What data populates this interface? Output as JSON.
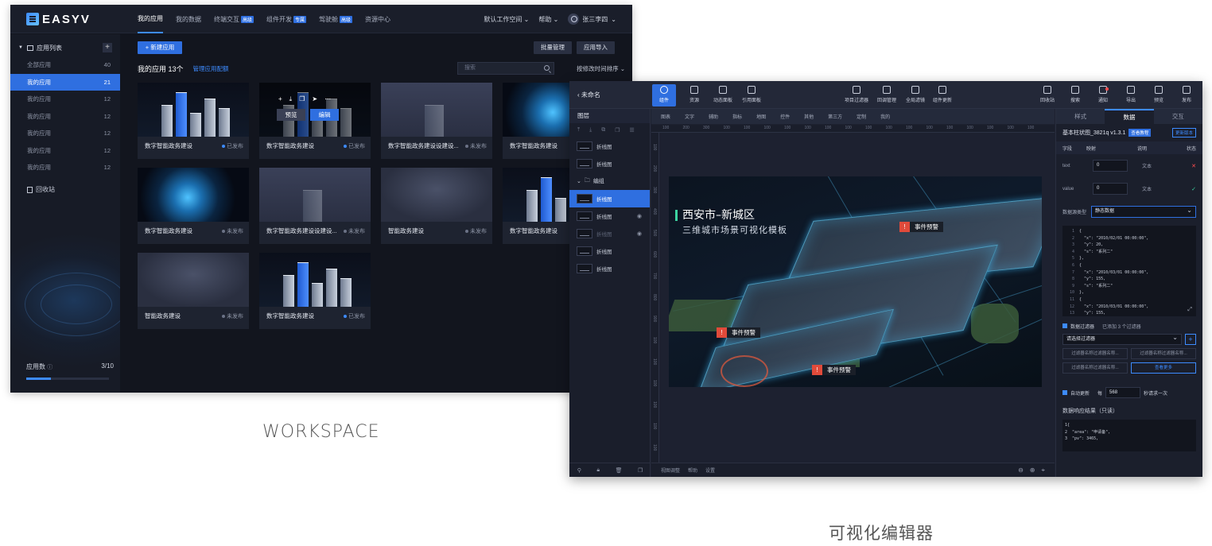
{
  "captions": {
    "workspace": "WORKSPACE",
    "editor": "可视化编辑器"
  },
  "workspace": {
    "logo": "EASYV",
    "nav": [
      {
        "label": "我的应用",
        "tag": ""
      },
      {
        "label": "我的数据",
        "tag": ""
      },
      {
        "label": "终端交互",
        "tag": "高级"
      },
      {
        "label": "组件开发",
        "tag": "专属"
      },
      {
        "label": "驾驶舱",
        "tag": "高级"
      },
      {
        "label": "资源中心",
        "tag": ""
      }
    ],
    "workspace_menu": "默认工作空间",
    "help": "帮助",
    "user": "张三李四",
    "sidebar": {
      "header": "应用列表",
      "items": [
        {
          "label": "全部应用",
          "count": "40"
        },
        {
          "label": "我的应用",
          "count": "21"
        },
        {
          "label": "我的应用",
          "count": "12"
        },
        {
          "label": "我的应用",
          "count": "12"
        },
        {
          "label": "我的应用",
          "count": "12"
        },
        {
          "label": "我的应用",
          "count": "12"
        },
        {
          "label": "我的应用",
          "count": "12"
        }
      ],
      "recycle": "回收站",
      "app_count_label": "应用数",
      "app_count_value": "3/10",
      "app_usage_fraction": 0.3
    },
    "main": {
      "new_app": "+ 新建应用",
      "batch": "批量管理",
      "import": "应用导入",
      "title": "我的应用 13个",
      "manage": "管理应用配额",
      "search_placeholder": "搜索",
      "sort": "按修改时间排序"
    },
    "cards": [
      {
        "name": "数字智能政务建设",
        "status": "已发布"
      },
      {
        "name": "数字智能政务建设",
        "status": "已发布"
      },
      {
        "name": "数字智能政务建设设建设...",
        "status": "未发布"
      },
      {
        "name": "数字智能政务建设",
        "status": ""
      },
      {
        "name": "数字智能政务建设",
        "status": "未发布"
      },
      {
        "name": "数字智能政务建设设建设...",
        "status": "未发布"
      },
      {
        "name": "智能政务建设",
        "status": "未发布"
      },
      {
        "name": "数字智能政务建设",
        "status": ""
      },
      {
        "name": "智能政务建设",
        "status": "未发布"
      },
      {
        "name": "数字智能政务建设",
        "status": "已发布"
      }
    ],
    "hover": {
      "preview": "预览",
      "edit": "编辑"
    }
  },
  "editor": {
    "back": "未命名",
    "tools_left": [
      "组件",
      "资源",
      "动态面板",
      "引用面板"
    ],
    "tools_mid": [
      "项目过滤器",
      "回调管理",
      "全局滤镜",
      "组件更新"
    ],
    "tools_right": [
      "回收站",
      "搜索",
      "通知",
      "导出",
      "预览",
      "发布"
    ],
    "layers": {
      "header": "图层",
      "items": [
        "折线图",
        "折线图",
        "编组",
        "折线图",
        "折线图",
        "折线图",
        "折线图",
        "折线图"
      ]
    },
    "comp_tabs": [
      "图表",
      "文字",
      "辅助",
      "指标",
      "地图",
      "控件",
      "其他",
      "第三方",
      "定制",
      "我的"
    ],
    "ruler_h": [
      "100",
      "200",
      "300",
      "100",
      "100",
      "100",
      "100",
      "100",
      "100",
      "100",
      "100",
      "100",
      "100",
      "100",
      "100",
      "100",
      "100",
      "100",
      "100"
    ],
    "ruler_v": [
      "100",
      "200",
      "300",
      "400",
      "500",
      "600",
      "700",
      "800",
      "900",
      "100",
      "100",
      "100",
      "100",
      "100",
      "100"
    ],
    "screen": {
      "title": "西安市–新城区",
      "subtitle": "三维城市场景可视化模板",
      "markers": [
        "事件预警",
        "事件预警",
        "事件预警"
      ]
    },
    "bottom": [
      "视图调整",
      "帮助",
      "设置"
    ],
    "panel": {
      "tabs": [
        "样式",
        "数据",
        "交互"
      ],
      "component": "基本柱状图_3821q v1.3.1",
      "view_tutorial": "查看教程",
      "update_version": "更新版本",
      "field_headers": [
        "字段",
        "映射",
        "说明",
        "状态"
      ],
      "fields": [
        {
          "name": "text",
          "value": "0",
          "desc": "文本",
          "ok": false
        },
        {
          "name": "value",
          "value": "0",
          "desc": "文本",
          "ok": true
        }
      ],
      "source_label": "数据源类型",
      "source_value": "静态数据",
      "code_lines": [
        "{",
        "  \"x\": \"2010/02/01 00:00:00\",",
        "  \"y\": 20,",
        "  \"s\": \"系列二\"",
        "},",
        "{",
        "  \"x\": \"2010/03/01 00:00:00\",",
        "  \"y\": 155,",
        "  \"s\": \"系列二\"",
        "},",
        "{",
        "  \"x\": \"2010/03/01 00:00:00\",",
        "  \"y\": 155,",
        "  \"s\": \"系列二\"",
        "},"
      ],
      "filter_label": "数据过滤器",
      "filter_added": "已添加 3 个过滤器",
      "filter_select": "请选择过滤器",
      "filter_chips": [
        "过滤器名称过滤器名称...",
        "过滤器名称过滤器名称...",
        "过滤器名称过滤器名称..."
      ],
      "see_more": "查看更多",
      "auto_update": "自动更新",
      "every": "每",
      "interval": "568",
      "per_seconds": "秒请求一次",
      "response_title": "数据响应结果（只读）",
      "resp_lines": [
        "{",
        "  \"area\": \"申请备\",",
        "  \"pv\": 3465,"
      ]
    }
  }
}
